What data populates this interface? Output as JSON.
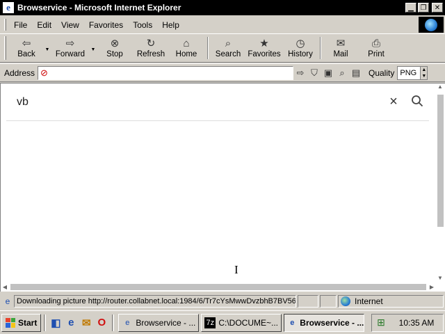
{
  "window": {
    "title": "Browservice - Microsoft Internet Explorer",
    "icon": "ie-icon",
    "controls": [
      "minimize-icon",
      "restore-icon",
      "close-icon"
    ]
  },
  "menu": {
    "items": [
      "File",
      "Edit",
      "View",
      "Favorites",
      "Tools",
      "Help"
    ]
  },
  "toolbar": {
    "back": "Back",
    "forward": "Forward",
    "stop": "Stop",
    "refresh": "Refresh",
    "home": "Home",
    "search": "Search",
    "favorites": "Favorites",
    "history": "History",
    "mail": "Mail",
    "print": "Print"
  },
  "address": {
    "label": "Address",
    "value": "",
    "quality_label": "Quality",
    "quality_value": "PNG"
  },
  "page": {
    "search_value": "vb"
  },
  "status": {
    "text": "Downloading picture http://router.collabnet.local:1984/6/Tr7cYsMwwDvzbhB7BV56",
    "zone": "Internet"
  },
  "taskbar": {
    "start": "Start",
    "tasks": [
      {
        "label": "Browservice - ...",
        "active": false
      },
      {
        "label": "C:\\DOCUME~...",
        "active": false
      },
      {
        "label": "Browservice - ...",
        "active": true
      }
    ],
    "clock": "10:35 AM"
  },
  "colors": {
    "titlebar": "#000000",
    "chrome": "#d4d0c8",
    "page_background": "#ffffff"
  }
}
